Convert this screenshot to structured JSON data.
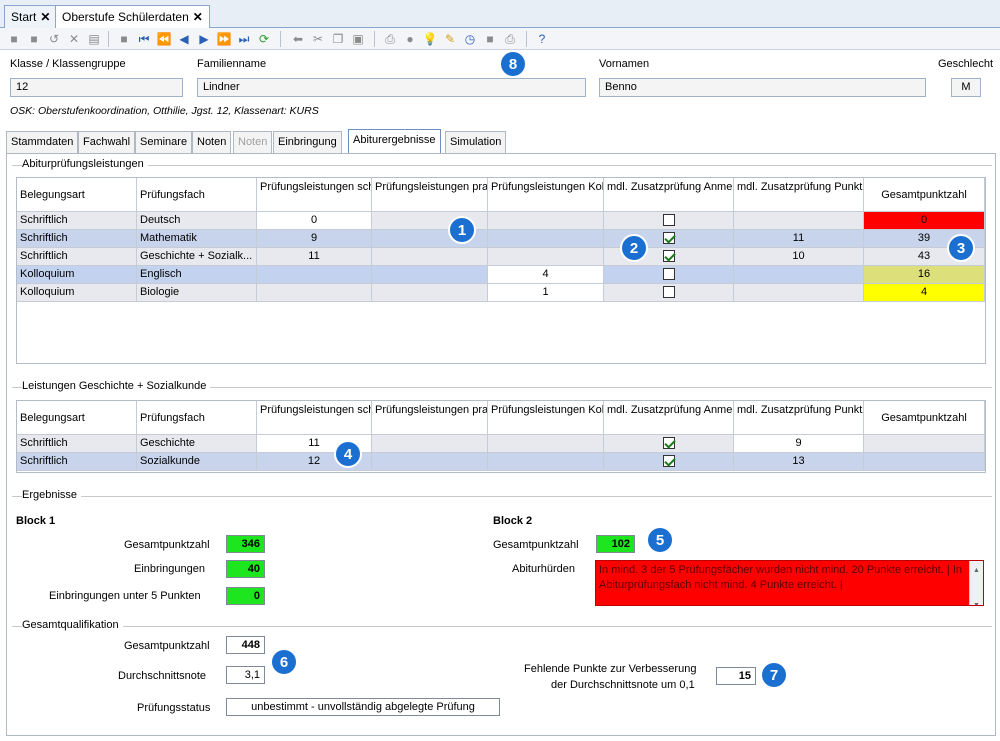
{
  "top_tabs": [
    {
      "label": "Start"
    },
    {
      "label": "Oberstufe Schülerdaten"
    }
  ],
  "header": {
    "klasse_label": "Klasse / Klassengruppe",
    "klasse_value": "12",
    "familienname_label": "Familienname",
    "familienname_value": "Lindner",
    "vornamen_label": "Vornamen",
    "vornamen_value": "Benno",
    "geschlecht_label": "Geschlecht",
    "geschlecht_value": "M",
    "info": "OSK: Oberstufenkoordination, Otthilie, Jgst. 12, Klassenart: KURS"
  },
  "page_tabs": [
    {
      "label": "Stammdaten"
    },
    {
      "label": "Fachwahl"
    },
    {
      "label": "Seminare"
    },
    {
      "label": "Noten"
    },
    {
      "label": "Noten"
    },
    {
      "label": "Einbringung"
    },
    {
      "label": "Abiturergebnisse"
    },
    {
      "label": "Simulation"
    }
  ],
  "section1": {
    "title": "Abiturprüfungsleistungen",
    "headers": [
      "Belegungsart",
      "Prüfungsfach",
      "Prüfungsleistungen schriftlich",
      "Prüfungsleistungen praktisch",
      "Prüfungsleistungen Kolloquium",
      "mdl. Zusatzprüfung Anmeldung",
      "mdl. Zusatzprüfung Punktzahl",
      "Gesamtpunktzahl"
    ],
    "rows": [
      {
        "belegung": "Schriftlich",
        "fach": "Deutsch",
        "schriftlich": "0",
        "praktisch": "",
        "kolloquium": "",
        "anmeldung": false,
        "punktzahl": "",
        "gesamt": "0",
        "color": "#ff0000"
      },
      {
        "belegung": "Schriftlich",
        "fach": "Mathematik",
        "schriftlich": "9",
        "praktisch": "",
        "kolloquium": "",
        "anmeldung": true,
        "punktzahl": "11",
        "gesamt": "39",
        "color": ""
      },
      {
        "belegung": "Schriftlich",
        "fach": "Geschichte + Sozialk...",
        "schriftlich": "11",
        "praktisch": "",
        "kolloquium": "",
        "anmeldung": true,
        "punktzahl": "10",
        "gesamt": "43",
        "color": ""
      },
      {
        "belegung": "Kolloquium",
        "fach": "Englisch",
        "schriftlich": "",
        "praktisch": "",
        "kolloquium": "4",
        "anmeldung": false,
        "punktzahl": "",
        "gesamt": "16",
        "color": "#dde07a"
      },
      {
        "belegung": "Kolloquium",
        "fach": "Biologie",
        "schriftlich": "",
        "praktisch": "",
        "kolloquium": "1",
        "anmeldung": false,
        "punktzahl": "",
        "gesamt": "4",
        "color": "#ffff00"
      }
    ]
  },
  "section2": {
    "title": "Leistungen Geschichte + Sozialkunde",
    "headers": [
      "Belegungsart",
      "Prüfungsfach",
      "Prüfungsleistungen schriftlich",
      "Prüfungsleistungen praktisch",
      "Prüfungsleistungen Kolloquium",
      "mdl. Zusatzprüfung Anmeldung",
      "mdl. Zusatzprüfung Punktzahl",
      "Gesamtpunktzahl"
    ],
    "rows": [
      {
        "belegung": "Schriftlich",
        "fach": "Geschichte",
        "schriftlich": "11",
        "anmeldung": true,
        "punktzahl": "9"
      },
      {
        "belegung": "Schriftlich",
        "fach": "Sozialkunde",
        "schriftlich": "12",
        "anmeldung": true,
        "punktzahl": "13"
      }
    ]
  },
  "ergebnisse": {
    "title": "Ergebnisse",
    "block1": {
      "title": "Block 1",
      "gesamt_label": "Gesamtpunktzahl",
      "gesamt_value": "346",
      "einbr_label": "Einbringungen",
      "einbr_value": "40",
      "unter5_label": "Einbringungen unter 5 Punkten",
      "unter5_value": "0"
    },
    "block2": {
      "title": "Block 2",
      "gesamt_label": "Gesamtpunktzahl",
      "gesamt_value": "102",
      "huerden_label": "Abiturhürden",
      "huerden_text": "In mind. 3 der 5 Prüfungsfächer wurden nicht mind. 20 Punkte erreicht. | In Abiturprüfungsfach nicht mind. 4 Punkte erreicht. |"
    }
  },
  "gesamtqualifikation": {
    "title": "Gesamtqualifikation",
    "gesamt_label": "Gesamtpunktzahl",
    "gesamt_value": "448",
    "durchschnitt_label": "Durchschnittsnote",
    "durchschnitt_value": "3,1",
    "status_label": "Prüfungsstatus",
    "status_value": "unbestimmt - unvollständig abgelegte Prüfung",
    "fehlend_label_1": "Fehlende Punkte zur Verbesserung",
    "fehlend_label_2": "der Durchschnittsnote um 0,1",
    "fehlend_value": "15"
  },
  "badges": [
    "1",
    "2",
    "3",
    "4",
    "5",
    "6",
    "7",
    "8"
  ],
  "colors": {
    "accent": "#1b6fd1",
    "ok_green": "#1ee61e",
    "error_red": "#ff0000",
    "warn_yellow": "#ffff00"
  }
}
